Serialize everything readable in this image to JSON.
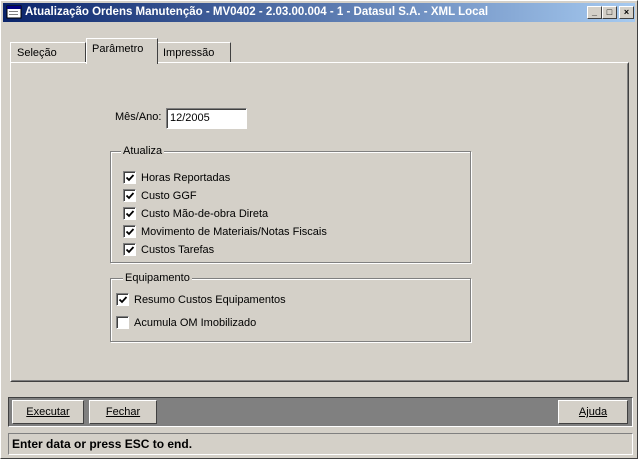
{
  "window": {
    "title": "Atualização Ordens Manutenção - MV0402 - 2.03.00.004 - 1 - Datasul S.A. - XML Local",
    "minimize_glyph": "_",
    "maximize_glyph": "□",
    "close_glyph": "×"
  },
  "tabs": [
    {
      "label": "Seleção",
      "active": false
    },
    {
      "label": "Parâmetro",
      "active": true
    },
    {
      "label": "Impressão",
      "active": false
    }
  ],
  "parametro": {
    "mes_ano_label": "Mês/Ano:",
    "mes_ano_value": "12/2005",
    "atualiza": {
      "title": "Atualiza",
      "items": [
        {
          "label": "Horas Reportadas",
          "checked": true
        },
        {
          "label": "Custo GGF",
          "checked": true
        },
        {
          "label": "Custo Mão-de-obra Direta",
          "checked": true
        },
        {
          "label": "Movimento de Materiais/Notas Fiscais",
          "checked": true
        },
        {
          "label": "Custos Tarefas",
          "checked": true
        }
      ]
    },
    "equipamento": {
      "title": "Equipamento",
      "items": [
        {
          "label": "Resumo Custos Equipamentos",
          "checked": true
        },
        {
          "label": "Acumula OM Imobilizado",
          "checked": false
        }
      ]
    }
  },
  "buttons": {
    "executar": "Executar",
    "fechar": "Fechar",
    "ajuda": "Ajuda"
  },
  "status_bar": "Enter data or press ESC to end."
}
